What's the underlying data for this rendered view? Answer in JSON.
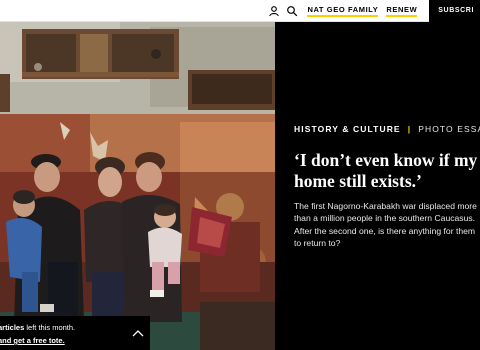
{
  "header": {
    "account_icon": "user-icon",
    "search_icon": "search-icon",
    "nat_geo_family": "NAT GEO FAMILY",
    "renew": "RENEW",
    "subscribe": "SUBSCRI",
    "accent_color": "#ffce00"
  },
  "article": {
    "section": "HISTORY & CULTURE",
    "separator": "|",
    "type": "PHOTO ESSAY",
    "headline": "‘I don’t even know if my home still exists.’",
    "dek": "The first Nagorno-Karabakh war displaced more than a million people in the southern Caucasus. After the second one, is there anything for them to return to?"
  },
  "meter": {
    "prefix": "articles",
    "suffix": " left this month.",
    "cta": "and get a free tote.",
    "toggle_icon": "chevron-up-icon"
  }
}
